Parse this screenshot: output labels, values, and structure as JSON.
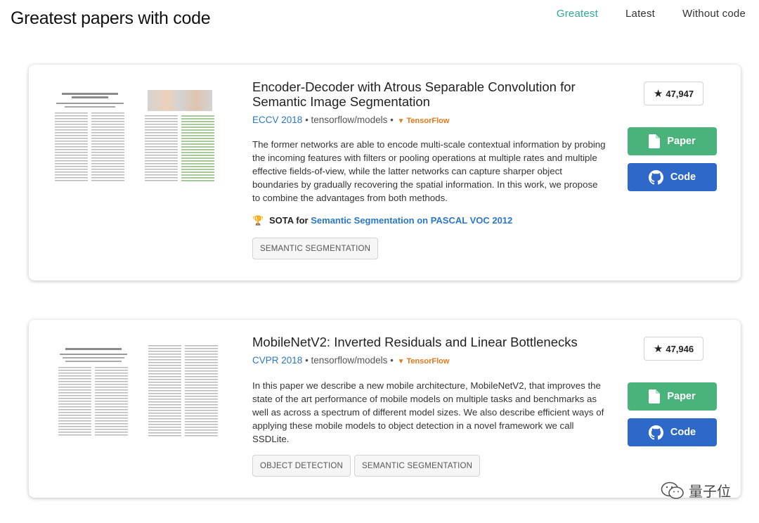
{
  "header": {
    "site_title": "Greatest papers with code",
    "nav": [
      {
        "label": "Greatest",
        "active": true
      },
      {
        "label": "Latest",
        "active": false
      },
      {
        "label": "Without code",
        "active": false
      }
    ]
  },
  "papers": [
    {
      "title": "Encoder-Decoder with Atrous Separable Convolution for Semantic Image Segmentation",
      "conference": "ECCV 2018",
      "repo": "tensorflow/models",
      "framework": "TensorFlow",
      "abstract": "The former networks are able to encode multi-scale contextual information by probing the incoming features with filters or pooling operations at multiple rates and multiple effective fields-of-view, while the latter networks can capture sharper object boundaries by gradually recovering the spatial information. In this work, we propose to combine the advantages from both methods.",
      "sota_prefix": "SOTA for",
      "sota_task": "Semantic Segmentation on PASCAL VOC 2012",
      "tags": [
        "SEMANTIC SEGMENTATION"
      ],
      "stars": "47,947",
      "paper_label": "Paper",
      "code_label": "Code"
    },
    {
      "title": "MobileNetV2: Inverted Residuals and Linear Bottlenecks",
      "conference": "CVPR 2018",
      "repo": "tensorflow/models",
      "framework": "TensorFlow",
      "abstract": "In this paper we describe a new mobile architecture, MobileNetV2, that improves the state of the art performance of mobile models on multiple tasks and benchmarks as well as across a spectrum of different model sizes. We also describe efficient ways of applying these mobile models to object detection in a novel framework we call SSDLite.",
      "tags": [
        "OBJECT DETECTION",
        "SEMANTIC SEGMENTATION"
      ],
      "stars": "47,946",
      "paper_label": "Paper",
      "code_label": "Code"
    }
  ],
  "watermark": "量子位",
  "colors": {
    "accent": "#2ea79a",
    "paper_button": "#49b37b",
    "code_button": "#2e68c8",
    "link": "#2a77c9",
    "framework": "#e8761a"
  }
}
